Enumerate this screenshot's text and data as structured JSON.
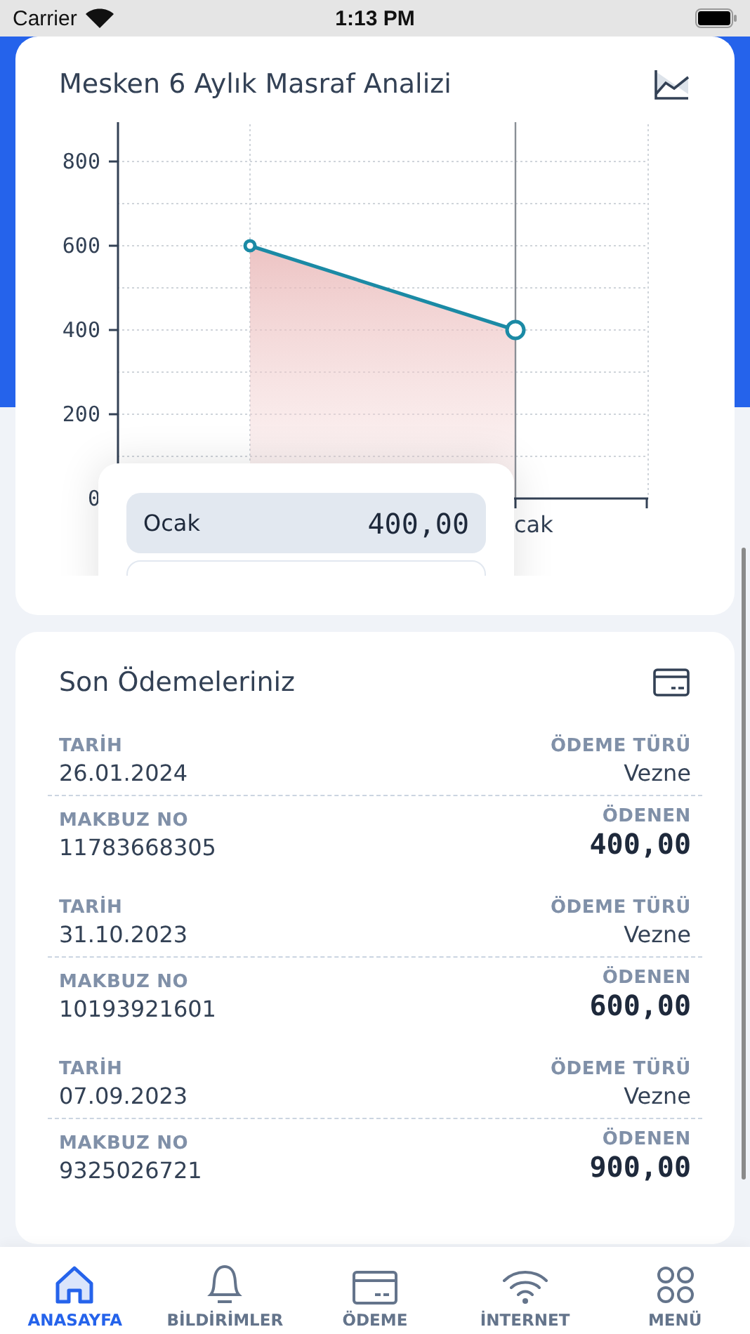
{
  "status_bar": {
    "carrier": "Carrier",
    "time": "1:13 PM"
  },
  "analysis": {
    "title": "Mesken 6 Aylık Masraf Analizi",
    "chart_data": {
      "type": "area",
      "grid": true,
      "values": [
        600,
        400
      ],
      "ylim": [
        0,
        900
      ],
      "yticks": [
        {
          "value": 0,
          "label": "0"
        },
        {
          "value": 200,
          "label": "200"
        },
        {
          "value": 400,
          "label": "400"
        },
        {
          "value": 600,
          "label": "600"
        },
        {
          "value": 800,
          "label": "800"
        }
      ],
      "annotations": [
        {
          "text": "cak"
        }
      ]
    },
    "tooltip": {
      "label": "Ocak",
      "value": "400,00"
    }
  },
  "payments": {
    "title": "Son Ödemeleriniz",
    "items": [
      {
        "date_label": "TARİH",
        "date": "26.01.2024",
        "type_label": "ÖDEME TÜRÜ",
        "type": "Vezne",
        "receipt_label": "MAKBUZ NO",
        "receipt": "11783668305",
        "amount_label": "ÖDENEN",
        "amount": "400,00"
      },
      {
        "date_label": "TARİH",
        "date": "31.10.2023",
        "type_label": "ÖDEME TÜRÜ",
        "type": "Vezne",
        "receipt_label": "MAKBUZ NO",
        "receipt": "10193921601",
        "amount_label": "ÖDENEN",
        "amount": "600,00"
      },
      {
        "date_label": "TARİH",
        "date": "07.09.2023",
        "type_label": "ÖDEME TÜRÜ",
        "type": "Vezne",
        "receipt_label": "MAKBUZ NO",
        "receipt": "9325026721",
        "amount_label": "ÖDENEN",
        "amount": "900,00"
      }
    ]
  },
  "tab_bar": [
    {
      "label": "ANASAYFA",
      "kind": "home",
      "selected": true
    },
    {
      "label": "BİLDİRİMLER",
      "kind": "bell",
      "selected": false
    },
    {
      "label": "ÖDEME",
      "kind": "card",
      "selected": false
    },
    {
      "label": "İNTERNET",
      "kind": "wifi",
      "selected": false
    },
    {
      "label": "MENÜ",
      "kind": "grid",
      "selected": false
    }
  ]
}
